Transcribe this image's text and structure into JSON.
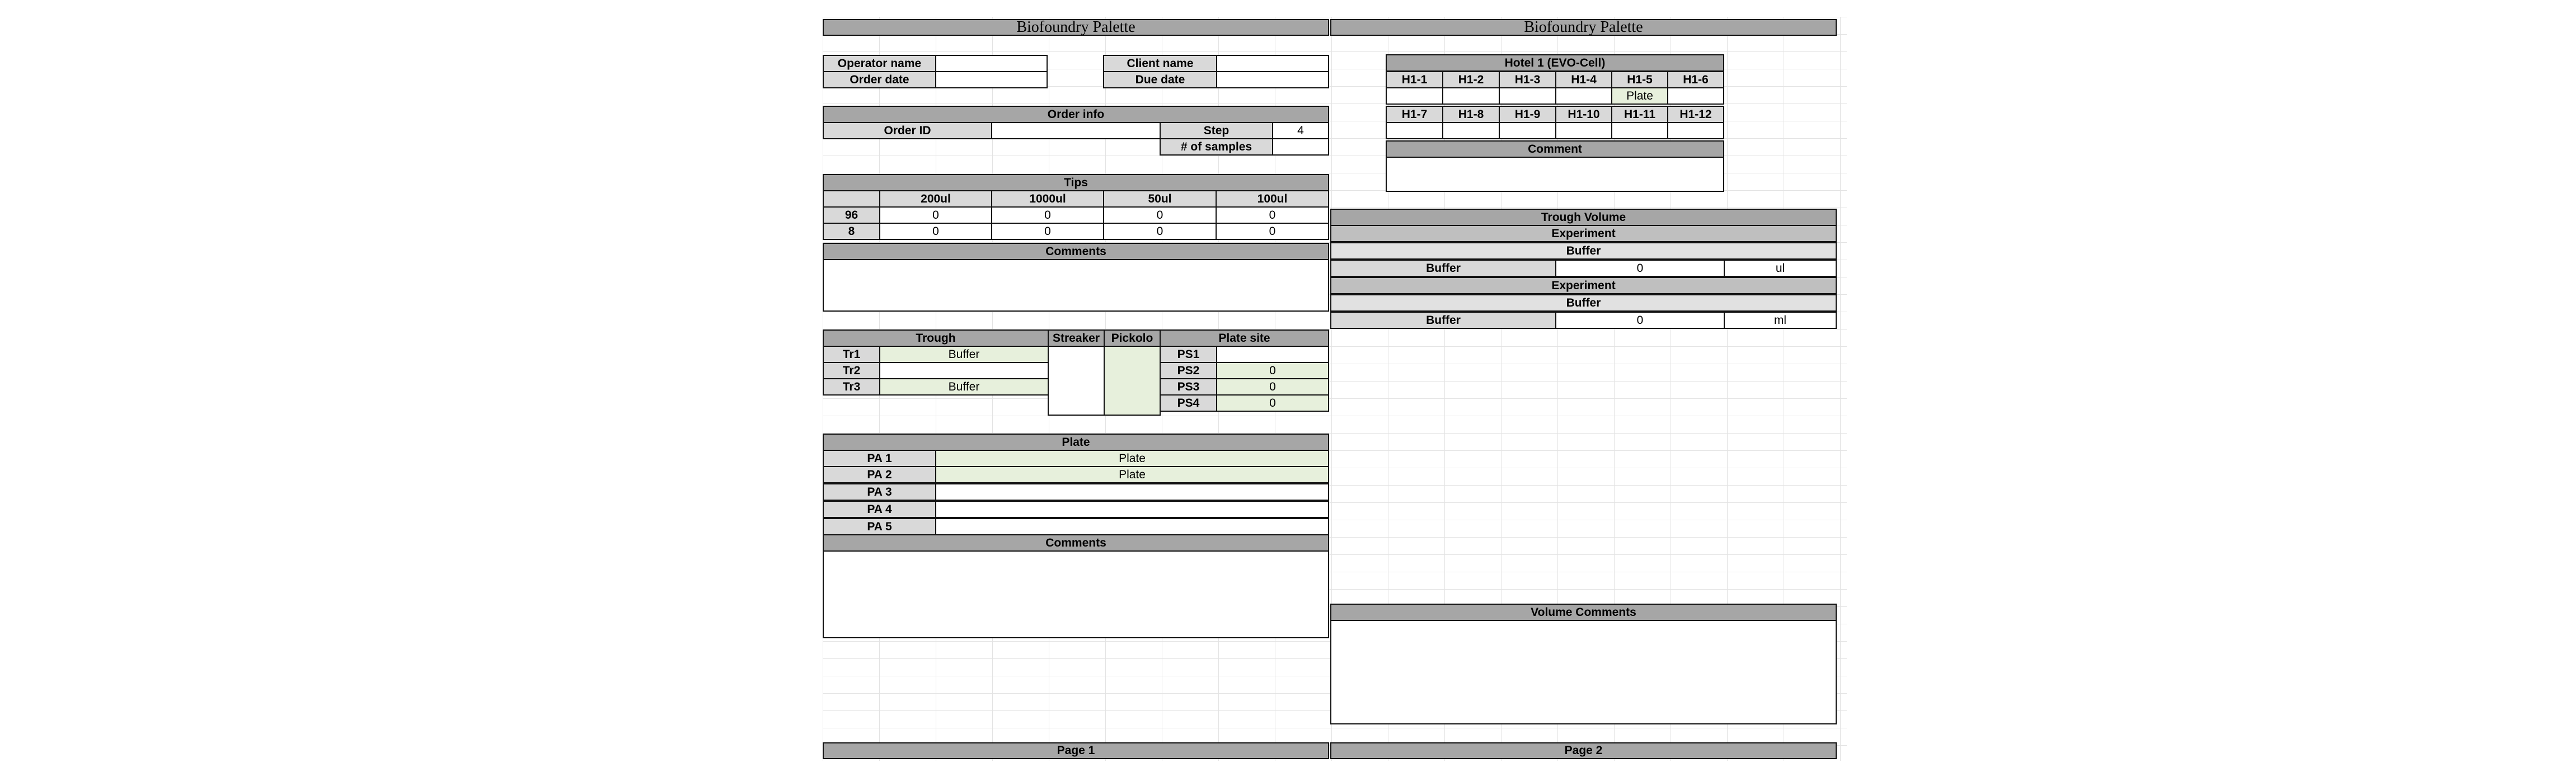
{
  "page1": {
    "title": "Biofoundry Palette",
    "operator_name_label": "Operator name",
    "operator_name_value": "",
    "client_name_label": "Client name",
    "client_name_value": "",
    "order_date_label": "Order date",
    "order_date_value": "",
    "due_date_label": "Due date",
    "due_date_value": "",
    "order_info": {
      "header": "Order info",
      "order_id_label": "Order ID",
      "order_id_value": "",
      "step_label": "Step",
      "step_value": "4",
      "samples_label": "# of samples",
      "samples_value": ""
    },
    "tips": {
      "header": "Tips",
      "columns": [
        "200ul",
        "1000ul",
        "50ul",
        "100ul"
      ],
      "rows": [
        {
          "label": "96",
          "values": [
            "0",
            "0",
            "0",
            "0"
          ]
        },
        {
          "label": "8",
          "values": [
            "0",
            "0",
            "0",
            "0"
          ]
        }
      ]
    },
    "comments1_header": "Comments",
    "trough": {
      "header": "Trough",
      "rows": [
        {
          "label": "Tr1",
          "value": "Buffer"
        },
        {
          "label": "Tr2",
          "value": ""
        },
        {
          "label": "Tr3",
          "value": "Buffer"
        }
      ]
    },
    "streaker_header": "Streaker",
    "pickolo_header": "Pickolo",
    "plate_site": {
      "header": "Plate site",
      "rows": [
        {
          "label": "PS1",
          "value": ""
        },
        {
          "label": "PS2",
          "value": "0"
        },
        {
          "label": "PS3",
          "value": "0"
        },
        {
          "label": "PS4",
          "value": "0"
        }
      ]
    },
    "plate": {
      "header": "Plate",
      "rows": [
        {
          "label": "PA 1",
          "value": "Plate"
        },
        {
          "label": "PA 2",
          "value": "Plate"
        },
        {
          "label": "PA 3",
          "value": ""
        },
        {
          "label": "PA 4",
          "value": ""
        },
        {
          "label": "PA 5",
          "value": ""
        }
      ]
    },
    "comments2_header": "Comments",
    "footer": "Page 1"
  },
  "page2": {
    "title": "Biofoundry Palette",
    "hotel": {
      "header": "Hotel 1 (EVO-Cell)",
      "row1_labels": [
        "H1-1",
        "H1-2",
        "H1-3",
        "H1-4",
        "H1-5",
        "H1-6"
      ],
      "row1_values": [
        "",
        "",
        "",
        "",
        "Plate",
        ""
      ],
      "row2_labels": [
        "H1-7",
        "H1-8",
        "H1-9",
        "H1-10",
        "H1-11",
        "H1-12"
      ],
      "row2_values": [
        "",
        "",
        "",
        "",
        "",
        ""
      ],
      "comment_header": "Comment"
    },
    "trough_volume": {
      "header": "Trough Volume",
      "blocks": [
        {
          "experiment": "Experiment",
          "name": "Buffer",
          "row_label": "Buffer",
          "value": "0",
          "unit": "ul"
        },
        {
          "experiment": "Experiment",
          "name": "Buffer",
          "row_label": "Buffer",
          "value": "0",
          "unit": "ml"
        }
      ]
    },
    "volume_comments_header": "Volume Comments",
    "footer": "Page 2"
  }
}
